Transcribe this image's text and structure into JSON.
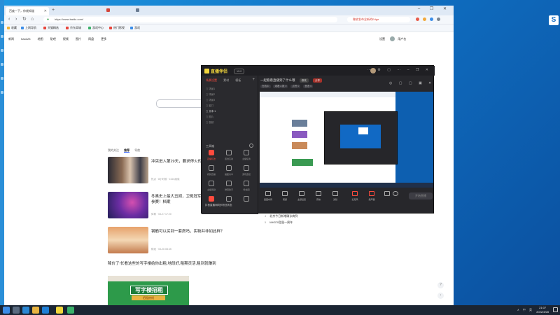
{
  "browser": {
    "tab_title": "百度一下，你就知道",
    "new_tab_symbol": "+",
    "window_controls": "– ❐ ✕",
    "url": "https://www.baidu.com/",
    "url_side_text": "微软发布全新的Edge",
    "bookmarks": [
      "收藏",
      "上网导航",
      "天猫精选",
      "京东商城",
      "游戏中心",
      "热门影视",
      "游戏"
    ],
    "top_nav": [
      "新闻",
      "hao123",
      "地图",
      "贴吧",
      "视频",
      "图片",
      "网盘",
      "更多"
    ],
    "top_right": {
      "items": [
        "设置"
      ],
      "user": "用户名"
    }
  },
  "feed": {
    "tabs": [
      "我的关注",
      "推荐",
      "导航"
    ],
    "active_tab": "推荐",
    "cards": [
      {
        "title": "冲突进入第29天，要求停火的声音越来越多",
        "meta": "热点 · 8小时前 · 1024阅读"
      },
      {
        "title": "冬奥史上最大丑闻，卫冕冠军被禁赛，导致无法参赛！档案",
        "meta": "体育 · 03-27 17:20"
      },
      {
        "title": "钢筋可以买到一套房吗，实物并非如此样？",
        "meta": "财经 · 03-26 08:45"
      }
    ],
    "text_item": "降价了!长看这些的写字楼给你出租,地段好,租期灵活,租到就赚到",
    "ad_main": "写字楼招租",
    "ad_sub": "招租热线"
  },
  "hot_list": [
    {
      "n": "4",
      "text": "北京今日新增确诊病例"
    },
    {
      "n": "5",
      "text": "MH370坠毁一周年"
    }
  ],
  "float_buttons": [
    "?",
    "↑"
  ],
  "app": {
    "logo": "直播伴侣",
    "version": "V6.0",
    "header_icons": "⋯ ⚙ ▢ ⋯ – ❐ ✕",
    "left_tabs": [
      "场景设置",
      "素材",
      "模板"
    ],
    "active_left_tab": "场景设置",
    "plus_symbol": "+",
    "scene_rows": [
      "▢ 场景1",
      "▢ 场景2",
      "▢ 场景3",
      "▢ 窗口",
      "▢ 文本 1",
      "▢ 图片",
      "▢ 视频"
    ],
    "section_title": "工具箱",
    "tools": [
      "直播玩法",
      "连线互动",
      "主播任务",
      "视频直播",
      "画面共享",
      "游戏连接",
      "主播奖励",
      "弹幕助手",
      "粉丝团",
      "直播数据",
      "直播回放",
      "更多"
    ],
    "bottom_note": "抖音直播间同步粉丝状态",
    "title": "一起看看直播到了什么哦",
    "title_btn1": "修改",
    "title_btn2": "分享",
    "stats": [
      "在线中",
      "观看人数 0",
      "点赞 0",
      "音浪 0"
    ],
    "right_controls": "◎ ▢ ▢ ▣ ✕",
    "bottom_bar": [
      "画面布局",
      "美颜",
      "主题设置",
      "音效",
      "滤镜",
      "麦克风",
      "扬声器"
    ],
    "go_live_label": "开始直播"
  },
  "taskbar": {
    "tray": "∧ 中 英",
    "time": "21:07",
    "date": "2022/3/28"
  },
  "colors": {
    "desktop": "#1a8ad6",
    "accent_red": "#ff4b3e",
    "logo_yellow": "#f2d63c",
    "app_bg": "#27272b"
  }
}
